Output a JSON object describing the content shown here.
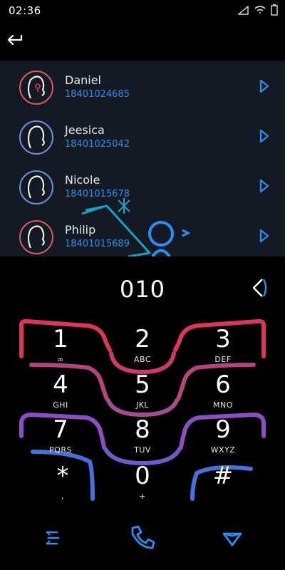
{
  "status_bar": {
    "time": "02:36"
  },
  "contacts": [
    {
      "name": "Daniel",
      "number": "18401024685",
      "color": "#d95a5e"
    },
    {
      "name": "Jeesica",
      "number": "18401025042",
      "color": "#6d8fd8"
    },
    {
      "name": "Nicole",
      "number": "18401015678",
      "color": "#6d8fd8"
    },
    {
      "name": "Philip",
      "number": "18401015689",
      "color": "#d95a5e"
    }
  ],
  "dialer": {
    "number": "010",
    "keys": [
      {
        "digit": "1",
        "letters": "∞"
      },
      {
        "digit": "2",
        "letters": "ABC"
      },
      {
        "digit": "3",
        "letters": "DEF"
      },
      {
        "digit": "4",
        "letters": "GHI"
      },
      {
        "digit": "5",
        "letters": "JKL"
      },
      {
        "digit": "6",
        "letters": "MNO"
      },
      {
        "digit": "7",
        "letters": "PQRS"
      },
      {
        "digit": "8",
        "letters": "TUV"
      },
      {
        "digit": "9",
        "letters": "WXYZ"
      },
      {
        "digit": "*",
        "letters": ","
      },
      {
        "digit": "0",
        "letters": "+"
      },
      {
        "digit": "#",
        "letters": ""
      }
    ]
  },
  "colors": {
    "accent": "#2f8ef0",
    "red": "#d9365a",
    "purple": "#8a4fc0",
    "blue": "#4a6fd8"
  },
  "icons": [
    "back-icon",
    "chevron-right-icon",
    "backspace-icon",
    "menu-icon",
    "phone-icon",
    "collapse-icon"
  ]
}
